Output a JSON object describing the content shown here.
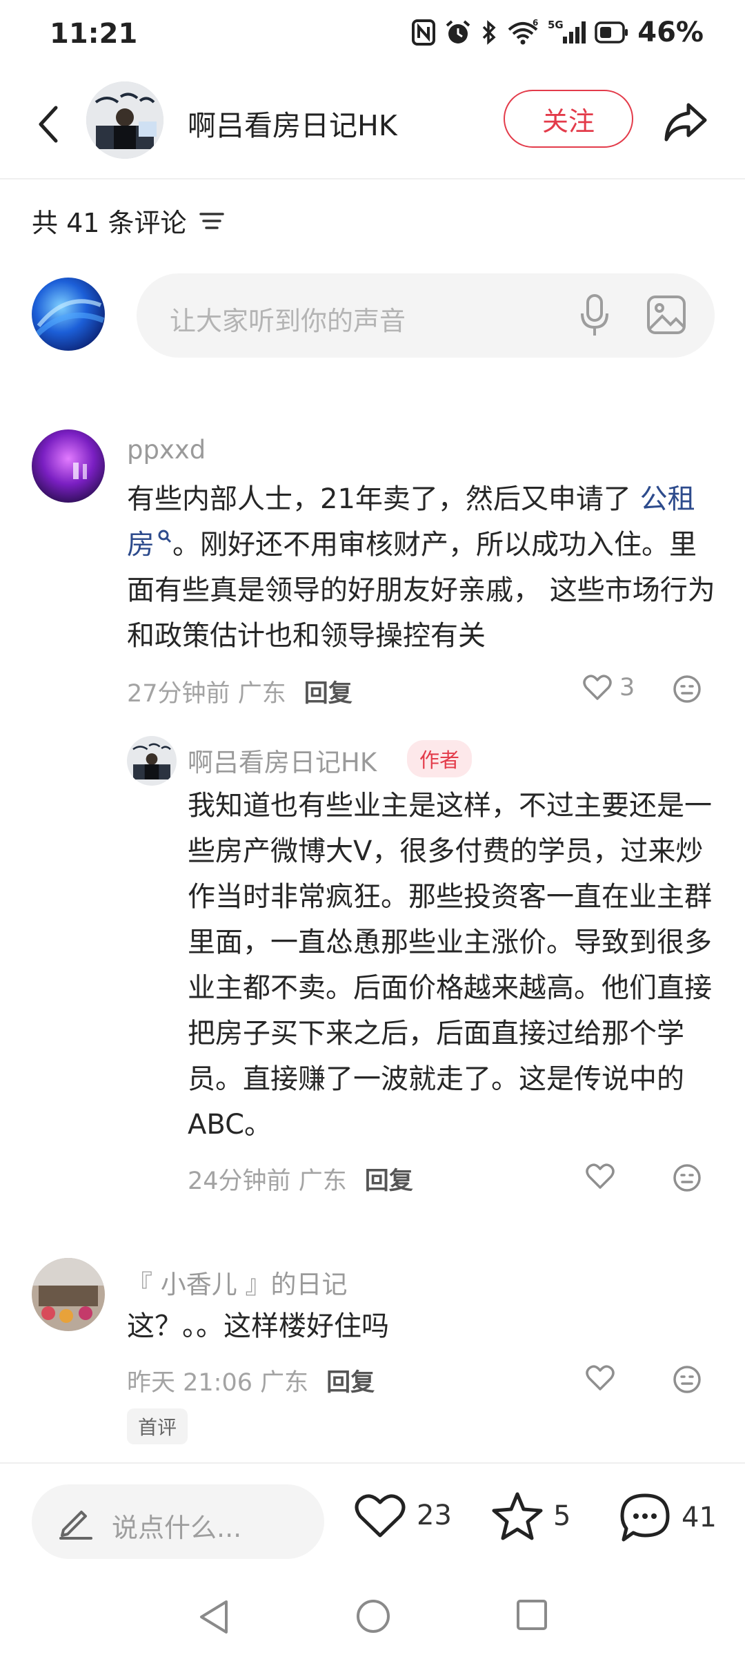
{
  "status_bar": {
    "time": "11:21",
    "network": "5G",
    "wifi_level": "6",
    "battery": "46%"
  },
  "header": {
    "account_name": "啊吕看房日记HK",
    "follow_label": "关注"
  },
  "comments_header": {
    "count_label": "共 41 条评论"
  },
  "composer": {
    "placeholder": "让大家听到你的声音"
  },
  "comments": [
    {
      "user": "ppxxd",
      "text_part1": "有些内部人士，21年卖了，然后又申请了",
      "link": "公租房",
      "text_part2": "。刚好还不用审核财产，所以成功入住。里面有些真是领导的好朋友好亲戚， 这些市场行为和政策估计也和领导操控有关",
      "time": "27分钟前",
      "location": "广东",
      "reply_label": "回复",
      "likes": "3",
      "replies": [
        {
          "user": "啊吕看房日记HK",
          "tag": "作者",
          "text": "我知道也有些业主是这样，不过主要还是一些房产微博大V，很多付费的学员，过来炒作当时非常疯狂。那些投资客一直在业主群里面，一直怂恿那些业主涨价。导致到很多业主都不卖。后面价格越来越高。他们直接把房子买下来之后，后面直接过给那个学员。直接赚了一波就走了。这是传说中的ABC。",
          "time": "24分钟前",
          "location": "广东",
          "reply_label": "回复"
        }
      ]
    },
    {
      "user": "『 小香儿 』的日记",
      "text": "这？。。这样楼好住吗",
      "time": "昨天 21:06",
      "location": "广东",
      "reply_label": "回复",
      "tag": "首评"
    }
  ],
  "bottom_bar": {
    "input_placeholder": "说点什么...",
    "likes": "23",
    "favorites": "5",
    "comments": "41"
  },
  "colors": {
    "accent": "#e33b4a",
    "link": "#2d4b8c",
    "muted": "#9a9a9a"
  }
}
